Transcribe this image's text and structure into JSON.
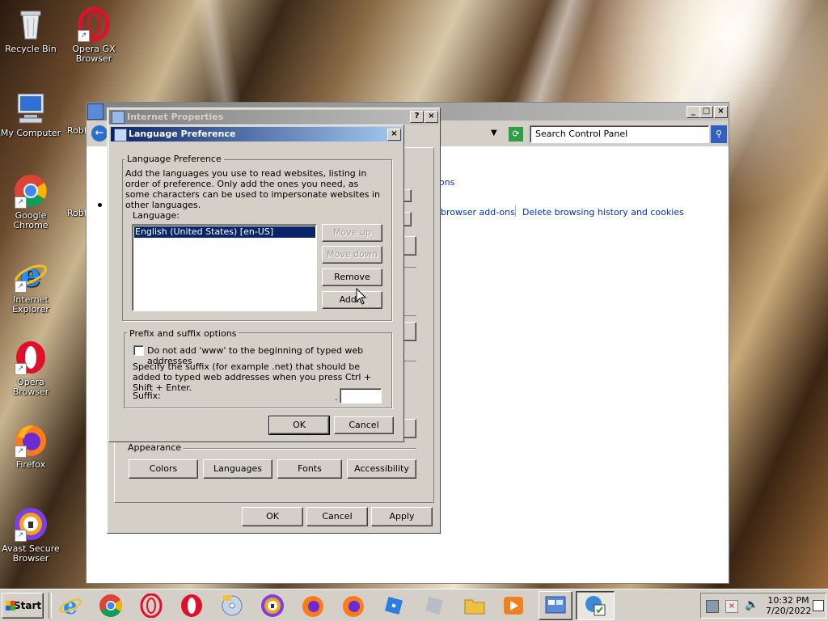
{
  "desktop": {
    "icons": [
      {
        "label": "Recycle Bin"
      },
      {
        "label": "Opera GX Browser"
      },
      {
        "label": "My Computer"
      },
      {
        "label": "Robl"
      },
      {
        "label": "Google Chrome"
      },
      {
        "label": "Robl"
      },
      {
        "label": "Internet Explorer"
      },
      {
        "label": "Opera Browser"
      },
      {
        "label": "Firefox"
      },
      {
        "label": "Avast Secure Browser"
      }
    ]
  },
  "control_panel": {
    "search_placeholder": "Search Control Panel",
    "partial_text_e": "e.",
    "partial_link_ons": "ons",
    "link_browser_addons": "browser add-ons",
    "link_delete_history": "Delete browsing history and cookies"
  },
  "internet_properties": {
    "title": "Internet Properties",
    "appearance_label": "Appearance",
    "buttons": {
      "colors": "Colors",
      "languages": "Languages",
      "fonts": "Fonts",
      "accessibility": "Accessibility",
      "ok": "OK",
      "cancel": "Cancel",
      "apply": "Apply"
    }
  },
  "language_preference": {
    "title": "Language Preference",
    "group_label": "Language Preference",
    "description": "Add the languages you use to read websites, listing in order of preference. Only add the ones you need, as some characters can be used to impersonate websites in other languages.",
    "language_label": "Language:",
    "languages": [
      "English (United States) [en-US]"
    ],
    "buttons": {
      "move_up": "Move up",
      "move_down": "Move down",
      "remove": "Remove",
      "add": "Add...",
      "ok": "OK",
      "cancel": "Cancel"
    },
    "prefix_group_label": "Prefix and suffix options",
    "www_checkbox_label": "Do not add 'www' to the beginning of typed web addresses",
    "www_checked": false,
    "suffix_description": "Specify the suffix (for example .net) that should be added to typed web addresses when you press Ctrl + Shift + Enter.",
    "suffix_label": "Suffix:",
    "suffix_value": ""
  },
  "taskbar": {
    "start_label": "Start",
    "time": "10:32 PM",
    "date": "7/20/2022"
  },
  "colors": {
    "title_active": "#0a246a",
    "title_gradient_end": "#a6caf0",
    "selection": "#0a246a",
    "link": "#0033cc",
    "face": "#d4d0c8"
  }
}
